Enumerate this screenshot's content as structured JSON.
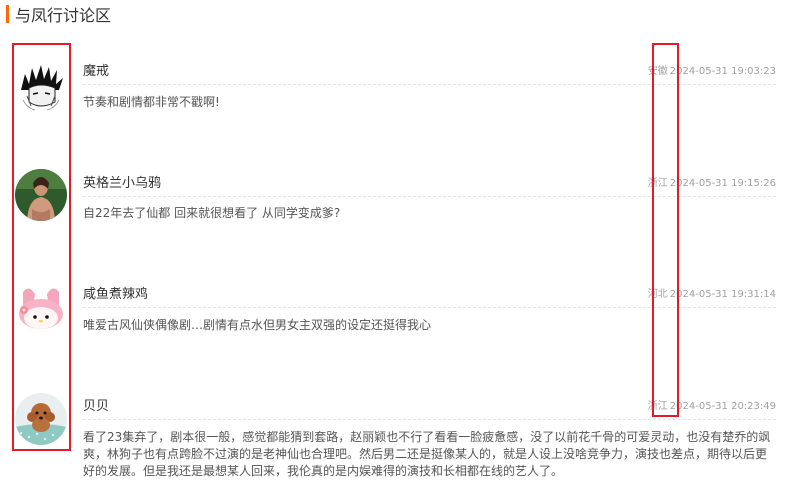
{
  "section": {
    "title": "与凤行讨论区"
  },
  "comments": [
    {
      "name": "魔戒",
      "location": "安徽",
      "time": "2024-05-31 19:03:23",
      "content": "节奏和剧情都非常不戳啊!",
      "avatar_icon": "anime-spiky-hair-avatar"
    },
    {
      "name": "英格兰小乌鸦",
      "location": "浙江",
      "time": "2024-05-31 19:15:26",
      "content": "自22年去了仙都 回来就很想看了 从同学变成爹?",
      "avatar_icon": "person-photo-avatar"
    },
    {
      "name": "咸鱼煮辣鸡",
      "location": "河北",
      "time": "2024-05-31 19:31:14",
      "content": "唯爱古风仙侠偶像剧…剧情有点水但男女主双强的设定还挺得我心",
      "avatar_icon": "my-melody-avatar"
    },
    {
      "name": "贝贝",
      "location": "浙江",
      "time": "2024-05-31 20:23:49",
      "content": "看了23集弃了，剧本很一般，感觉都能猜到套路，赵丽颖也不行了看看一脸疲惫感，没了以前花千骨的可爱灵动，也没有楚乔的飒爽，林狗子也有点跨脸不过演的是老神仙也合理吧。然后男二还是挺像某人的，就是人设上没啥竞争力，演技也差点，期待以后更好的发展。但是我还是最想某人回来，我伦真的是内娱难得的演技和长相都在线的艺人了。",
      "avatar_icon": "poodle-dog-avatar"
    }
  ],
  "colors": {
    "accent": "#ff6a00",
    "highlight": "#e11a2c",
    "meta_text": "#a0a0a0"
  }
}
